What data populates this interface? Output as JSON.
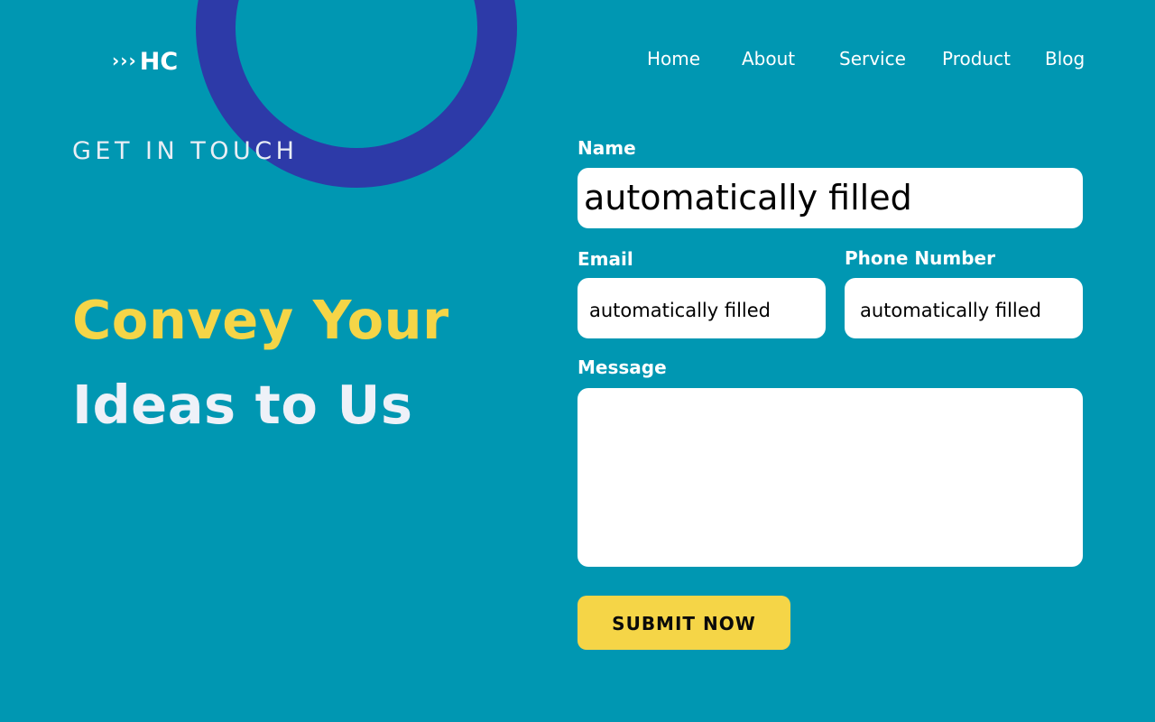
{
  "logo": {
    "chevrons": "›››",
    "text": "HC"
  },
  "nav": {
    "items": [
      {
        "label": "Home"
      },
      {
        "label": "About"
      },
      {
        "label": "Service"
      },
      {
        "label": "Product"
      },
      {
        "label": "Blog"
      }
    ]
  },
  "hero": {
    "eyebrow": "GET IN TOUCH",
    "headline_line1": "Convey Your",
    "headline_line2": "Ideas to Us"
  },
  "form": {
    "name_label": "Name",
    "name_value": "automatically filled",
    "email_label": "Email",
    "email_value": "automatically filled",
    "phone_label": "Phone Number",
    "phone_value": "automatically filled",
    "message_label": "Message",
    "message_value": "",
    "submit_label": "SUBMIT NOW"
  },
  "colors": {
    "background": "#0097b2",
    "accent_yellow": "#f5d547",
    "ring_blue": "#2d3aa8",
    "field_white": "#ffffff"
  }
}
